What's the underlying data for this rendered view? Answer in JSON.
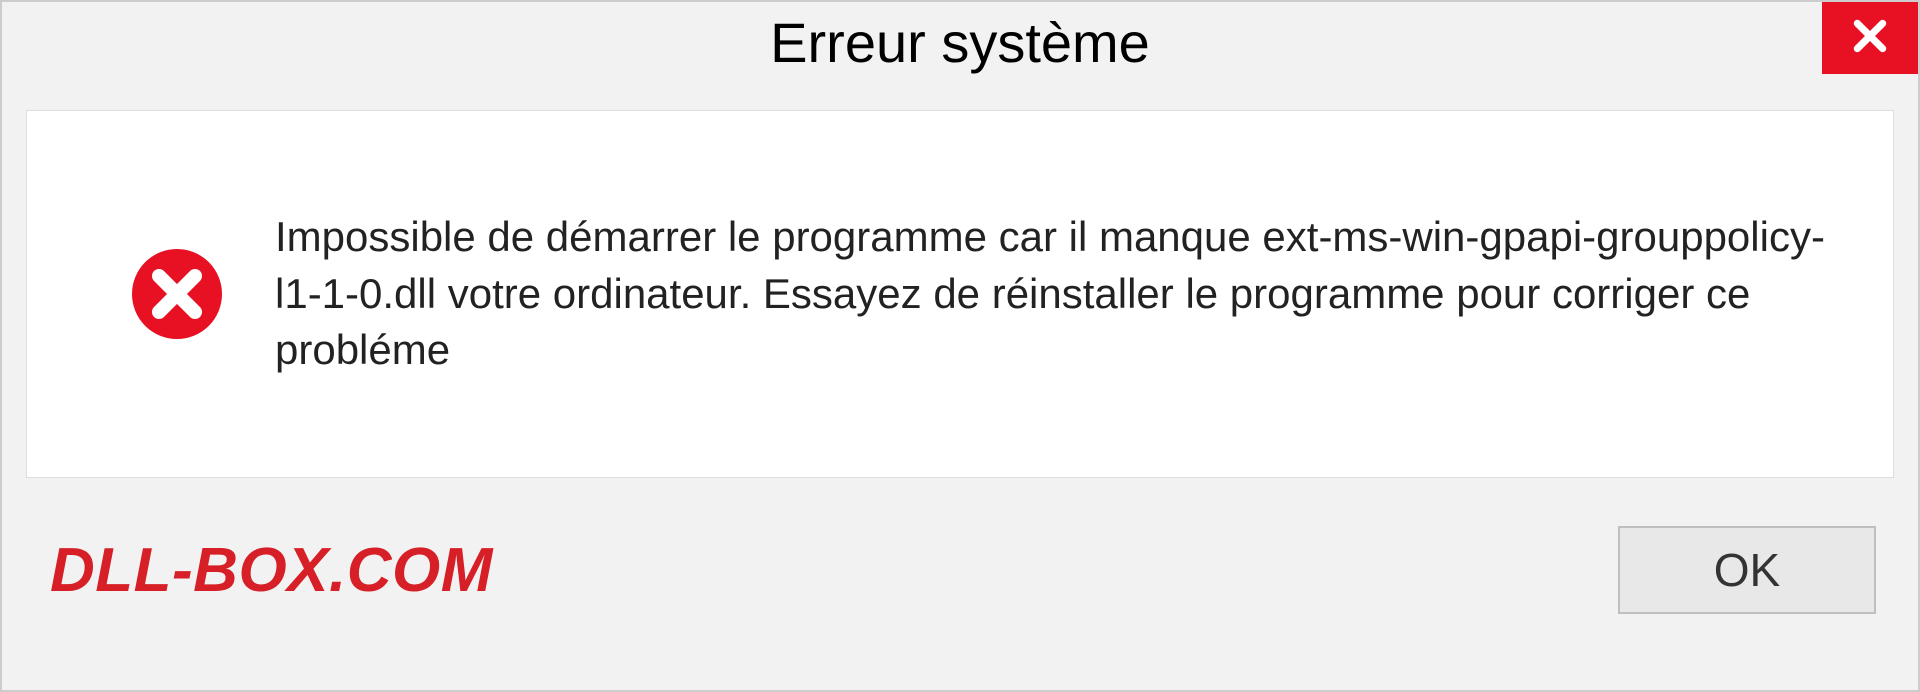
{
  "dialog": {
    "title": "Erreur système",
    "message": "Impossible de démarrer le programme car il manque ext-ms-win-gpapi-grouppolicy-l1-1-0.dll votre ordinateur. Essayez de réinstaller le programme pour corriger ce probléme",
    "ok_label": "OK"
  },
  "watermark": "DLL-BOX.COM",
  "colors": {
    "accent_red": "#e81123",
    "brand_red": "#d61f26"
  }
}
